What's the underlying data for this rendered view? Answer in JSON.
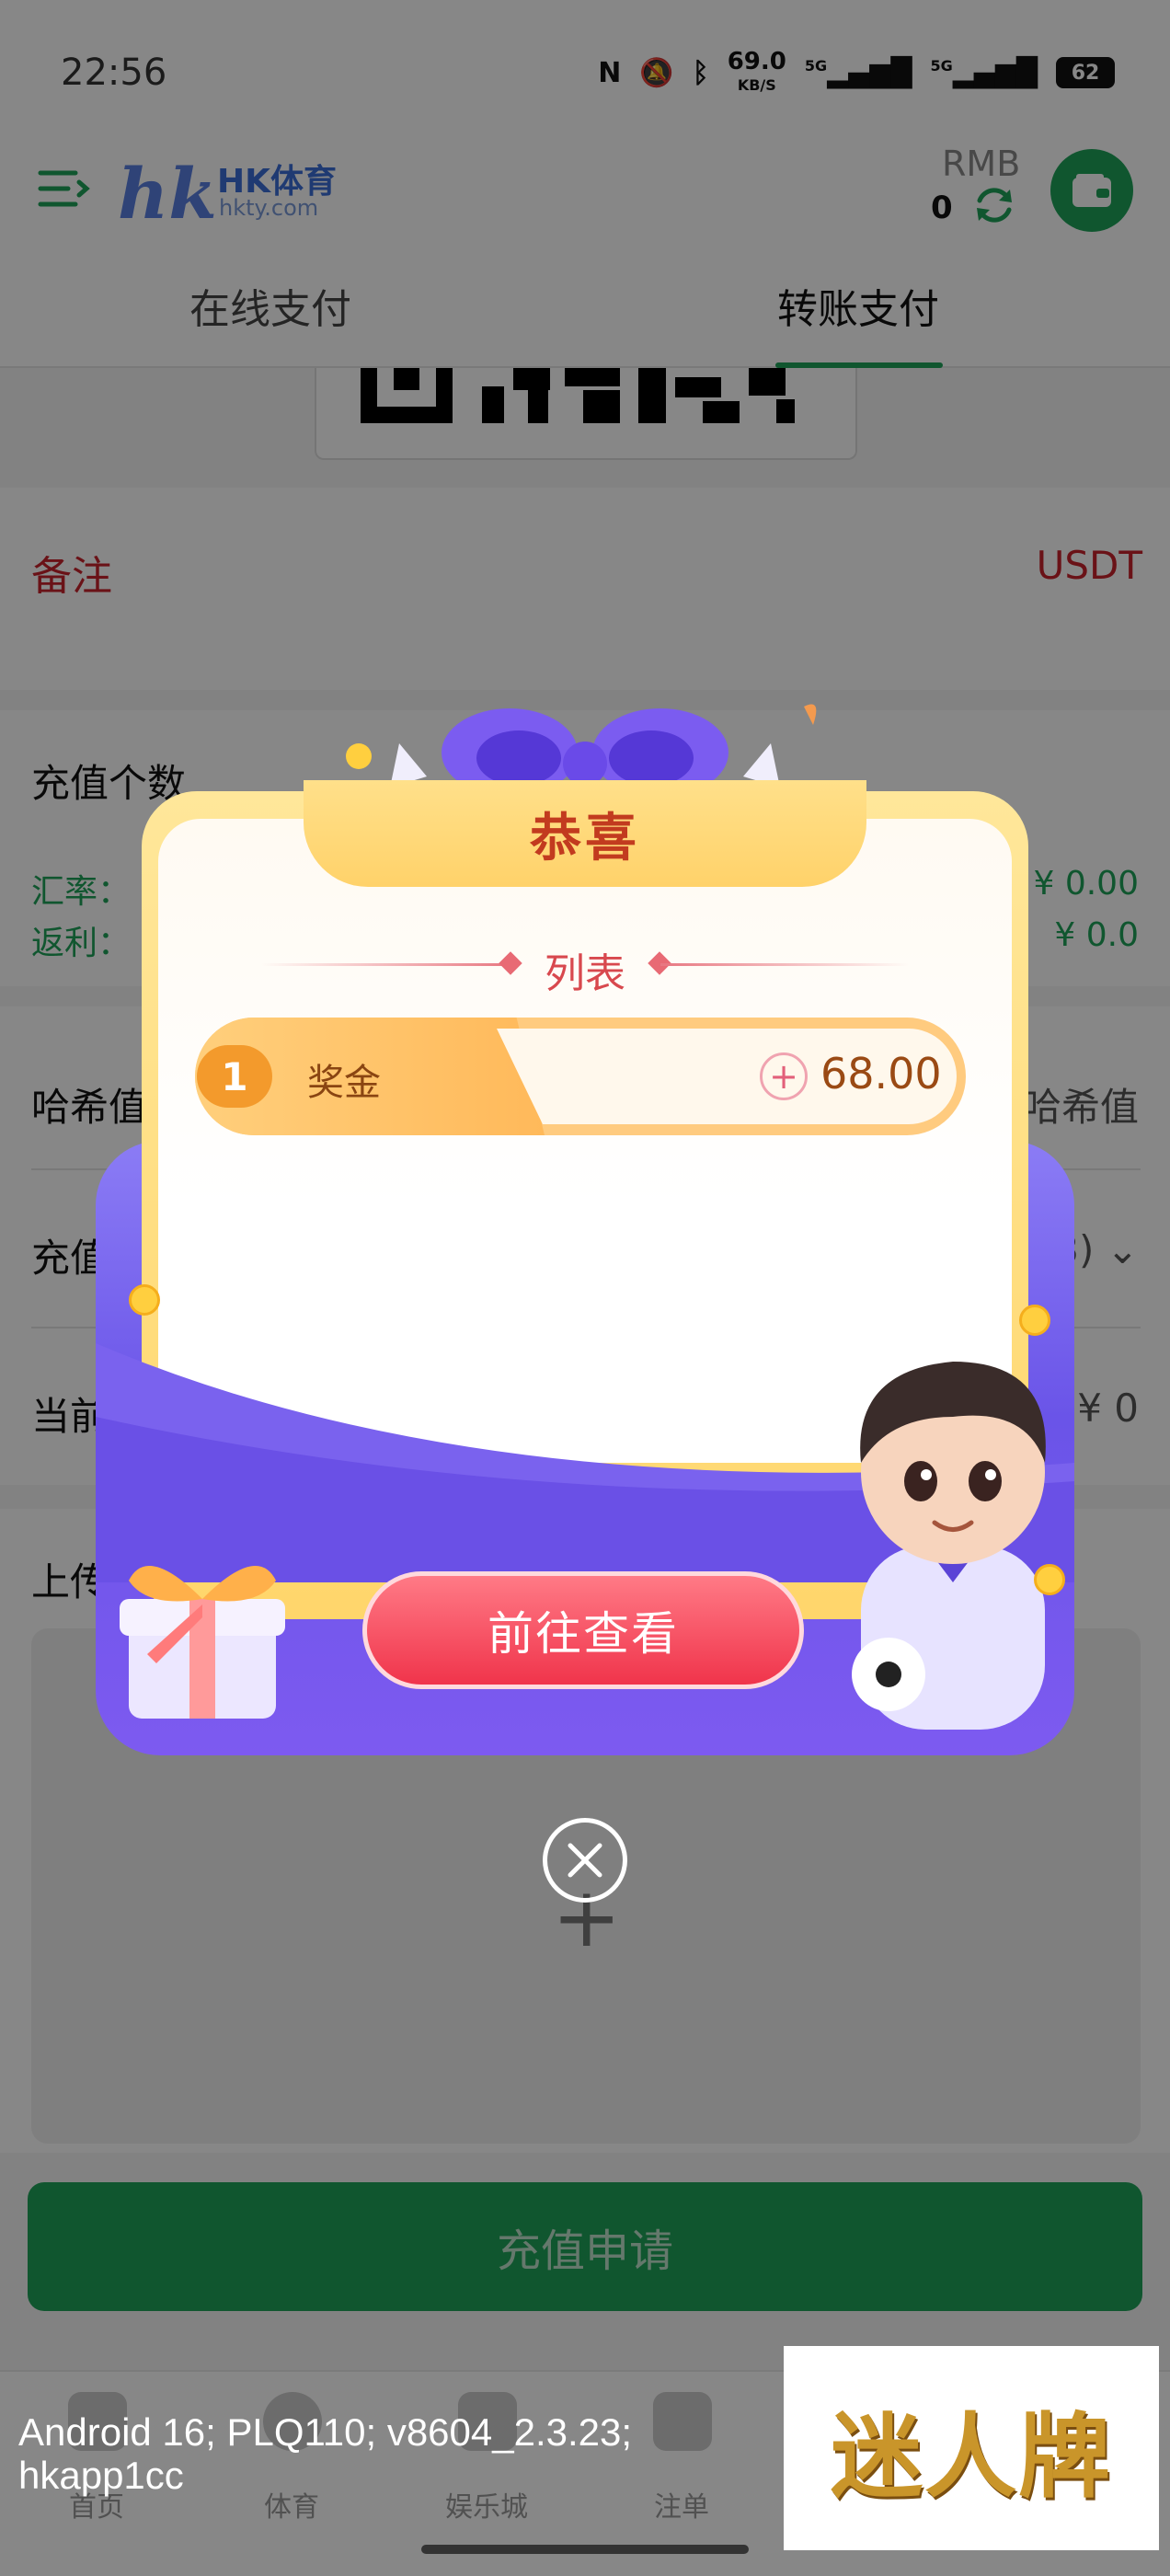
{
  "status_bar": {
    "time": "22:56",
    "net_speed": "69.0",
    "net_unit": "KB/S",
    "signal_1": "5G",
    "signal_2": "5G",
    "battery": "62"
  },
  "header": {
    "logo_mark": "hk",
    "logo_name": "HK体育",
    "logo_domain": "hkty.com",
    "currency": "RMB",
    "balance": "0"
  },
  "tabs": [
    {
      "label": "在线支付",
      "active": false
    },
    {
      "label": "转账支付",
      "active": true
    }
  ],
  "form": {
    "remark_label": "备注",
    "remark_value": "USDT",
    "amount_label": "充值个数",
    "rate_label": "汇率：",
    "rebate_label": "返利：",
    "rate_value": "¥ 0.00",
    "rebate_value": "¥ 0.0",
    "hash_label": "哈希值",
    "hash_value": "哈希值",
    "charge_label": "充值",
    "charge_value": "3)",
    "current_label": "当前",
    "current_value": "¥ 0",
    "upload_label": "上传",
    "upload_plus": "+",
    "submit_label": "充值申请"
  },
  "bottom_nav": [
    {
      "label": "首页"
    },
    {
      "label": "体育"
    },
    {
      "label": "娱乐城"
    },
    {
      "label": "注单"
    }
  ],
  "modal": {
    "title": "恭喜",
    "list_title": "列表",
    "items": [
      {
        "index": "1",
        "label": "奖金",
        "sign": "+",
        "amount": "68.00"
      }
    ],
    "view_button": "前往查看",
    "close_icon": "close-icon"
  },
  "footer": {
    "device_info_line1": "Android 16; PLQ110; v8604_2.3.23;",
    "device_info_line2": "hkapp1cc",
    "brand": "迷人牌"
  },
  "colors": {
    "accent_green": "#1fa25a",
    "remark_red": "#c8232c",
    "modal_purple": "#6a54e8",
    "modal_gold": "#ffd66b",
    "view_button": "#f0344b"
  }
}
